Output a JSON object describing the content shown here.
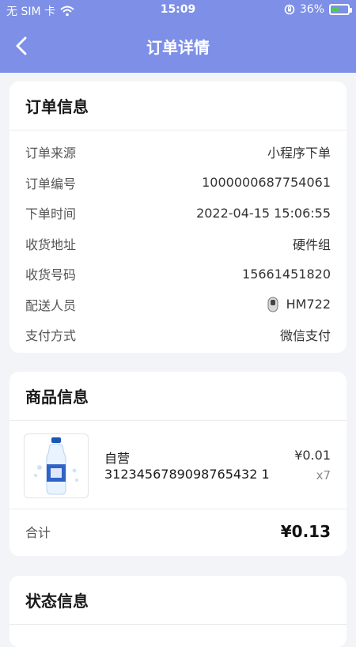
{
  "status_bar": {
    "carrier": "无 SIM 卡",
    "time": "15:09",
    "battery": "36%"
  },
  "nav": {
    "title": "订单详情"
  },
  "order_info": {
    "title": "订单信息",
    "rows": [
      {
        "label": "订单来源",
        "value": "小程序下单"
      },
      {
        "label": "订单编号",
        "value": "1000000687754061"
      },
      {
        "label": "下单时间",
        "value": "2022-04-15 15:06:55"
      },
      {
        "label": "收货地址",
        "value": "硬件组"
      },
      {
        "label": "收货号码",
        "value": "15661451820"
      },
      {
        "label": "配送人员",
        "value": "HM722"
      },
      {
        "label": "支付方式",
        "value": "微信支付"
      }
    ]
  },
  "product_info": {
    "title": "商品信息",
    "item": {
      "name": "自营",
      "sku": "3123456789098765432 1",
      "price": "¥0.01",
      "qty": "x7"
    },
    "total_label": "合计",
    "total_value": "¥0.13"
  },
  "status_info": {
    "title": "状态信息"
  },
  "colors": {
    "header": "#7d8fe6",
    "background": "#f3f4f8",
    "card": "#ffffff"
  }
}
